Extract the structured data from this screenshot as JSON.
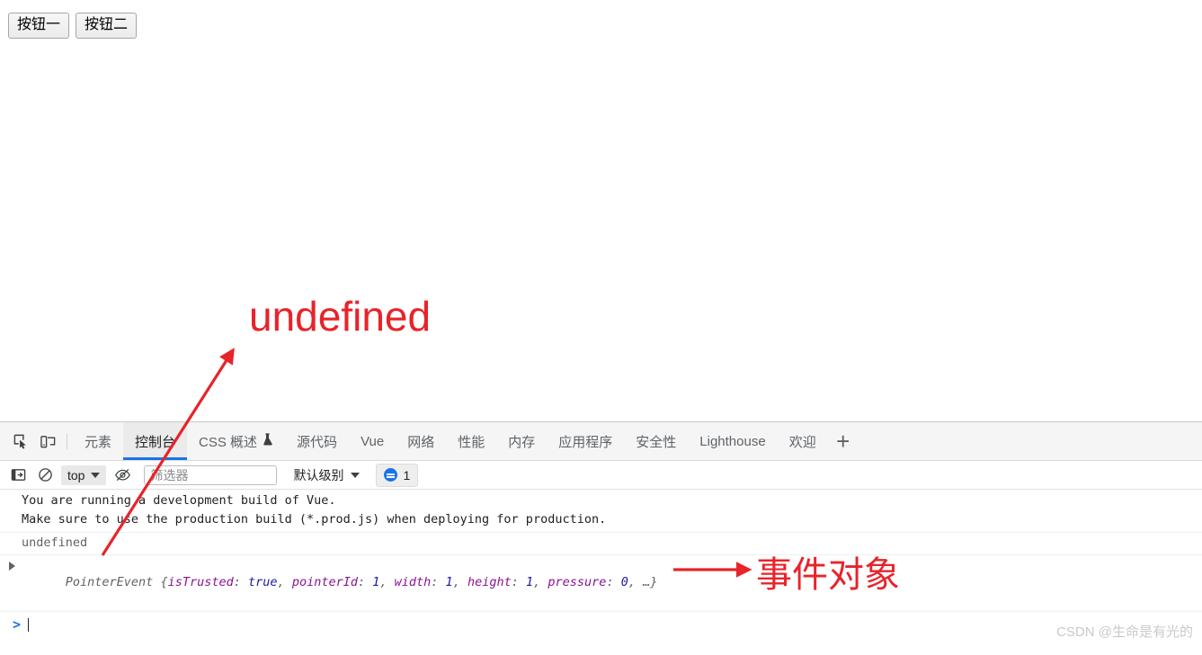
{
  "page": {
    "buttons": [
      {
        "label": "按钮一"
      },
      {
        "label": "按钮二"
      }
    ]
  },
  "devtools": {
    "toolbar_icons": [
      {
        "name": "inspect-element-icon"
      },
      {
        "name": "device-toolbar-icon"
      }
    ],
    "tabs": [
      {
        "label": "元素",
        "active": false
      },
      {
        "label": "控制台",
        "active": true
      },
      {
        "label": "CSS 概述",
        "active": false,
        "icon": "beaker-icon"
      },
      {
        "label": "源代码",
        "active": false
      },
      {
        "label": "Vue",
        "active": false
      },
      {
        "label": "网络",
        "active": false
      },
      {
        "label": "性能",
        "active": false
      },
      {
        "label": "内存",
        "active": false
      },
      {
        "label": "应用程序",
        "active": false
      },
      {
        "label": "安全性",
        "active": false
      },
      {
        "label": "Lighthouse",
        "active": false
      },
      {
        "label": "欢迎",
        "active": false
      }
    ],
    "add_tab_label": "+",
    "console_toolbar": {
      "sidebar_toggle_icon": "sidebar-toggle-icon",
      "clear_console_icon": "clear-console-icon",
      "context": "top",
      "live_expression_icon": "eye-icon",
      "filter_placeholder": "筛选器",
      "filter_value": "",
      "level": "默认级别",
      "message_count": "1"
    },
    "console": {
      "warning_lines": [
        "You are running a development build of Vue.",
        "Make sure to use the production build (*.prod.js) when deploying for production."
      ],
      "undefined_output": "undefined",
      "object_line": {
        "constructor": "PointerEvent",
        "open_brace": "{",
        "props": [
          {
            "key": "isTrusted",
            "sep": ": ",
            "value": "true",
            "comma": ", "
          },
          {
            "key": "pointerId",
            "sep": ": ",
            "value": "1",
            "comma": ", "
          },
          {
            "key": "width",
            "sep": ": ",
            "value": "1",
            "comma": ", "
          },
          {
            "key": "height",
            "sep": ": ",
            "value": "1",
            "comma": ", "
          },
          {
            "key": "pressure",
            "sep": ": ",
            "value": "0",
            "comma": ", "
          }
        ],
        "ellipsis": "…",
        "close_brace": "}"
      },
      "prompt_caret": ">",
      "prompt_value": ""
    }
  },
  "annotations": {
    "undefined_label": "undefined",
    "event_object_label": "事件对象",
    "color": "#e8232a"
  },
  "watermark": {
    "text": "CSDN @生命是有光的"
  }
}
